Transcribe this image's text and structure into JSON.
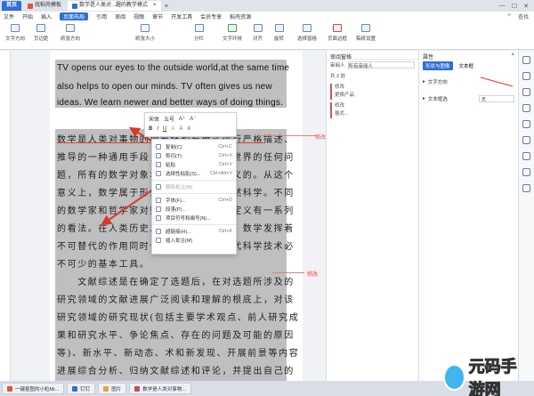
{
  "titlebar": {
    "tabs": [
      {
        "label": "首页",
        "color": "#2f6fd6"
      },
      {
        "label": "找稻壳模板",
        "color": "#e4543b"
      },
      {
        "label": "数学是人类对...趣的教学模式",
        "color": "#2f6fd6"
      }
    ]
  },
  "menubar": {
    "items": [
      "文件",
      "开始",
      "插入",
      "页面布局",
      "引用",
      "审阅",
      "视图",
      "章节",
      "开发工具",
      "会员专享",
      "稻壳资源"
    ],
    "active_index": 3,
    "search": "查找"
  },
  "ribbon": {
    "groups": [
      "文字方向",
      "页边距",
      "纸张方向",
      "纸张大小",
      "分栏",
      "文字环绕",
      "对齐",
      "旋转",
      "选择窗格",
      "页面边框",
      "稿纸设置"
    ]
  },
  "document": {
    "english_lines": [
      "TV opens our eyes to the outside world,at the same time",
      "also helps to open our minds. TV often gives us new",
      "ideas. We learn newer and better ways of doing things."
    ],
    "chinese_lines": [
      "数学是人类对事物的抽象结构与模式进行严格描述、",
      "推导的一种通用手段，可以应用于现实世界的任何问",
      "题，所有的数学对象本质上都是人为定义的。从这个",
      "意义上，数学属于形式科学，而不是自然科学。不同",
      "的数学家和哲学家对数学的确切范围和定义有一系列",
      "的看法。在人类历史发展和社会生活中，数学发挥着",
      "不可替代的作用同时也是学习和研究现代科学技术必",
      "不可少的基本工具。",
      "　　文献综述是在确定了选题后，在对选题所涉及的",
      "研究领域的文献进展广泛阅读和理解的根底上，对该",
      "研究领域的研究现状(包括主要学术观点、前人研究成",
      "果和研究水平、争论焦点、存在的问题及可能的原因",
      "等)、新水平、新动态、术和新发现、开展前景等内容",
      "进展综合分析、归纳文献综述和评论，并提出自己的"
    ]
  },
  "minitoolbar": {
    "font": "宋体",
    "size": "五号"
  },
  "context_menu": {
    "items": [
      {
        "label": "复制(C)",
        "shortcut": "Ctrl+C"
      },
      {
        "label": "剪切(T)",
        "shortcut": "Ctrl+X"
      },
      {
        "label": "粘贴",
        "shortcut": "Ctrl+V"
      },
      {
        "label": "选择性粘贴(S)...",
        "shortcut": "Ctrl+Alt+V"
      },
      {
        "label": "删除批注(M)",
        "shortcut": "",
        "dim": true
      },
      {
        "label": "字体(F)...",
        "shortcut": "Ctrl+D"
      },
      {
        "label": "段落(P)...",
        "shortcut": ""
      },
      {
        "label": "项目符号和编号(N)...",
        "shortcut": ""
      },
      {
        "label": "超链接(H)...",
        "shortcut": "Ctrl+K"
      },
      {
        "label": "插入批注(M)",
        "shortcut": ""
      }
    ]
  },
  "comments": {
    "marks": [
      "修改",
      "修改"
    ]
  },
  "review_panel": {
    "title": "审阅窗格",
    "reviewer_label": "审阅人",
    "reviewer_value": "所有审阅人",
    "count_text": "共 2 处",
    "block1_title": "修改",
    "block1_text": "更换产品",
    "block2_title": "修改",
    "block2_text": "格式..."
  },
  "property_panel": {
    "title": "属性",
    "tabs": [
      "形状与图像",
      "文本框"
    ],
    "row1": "文字方向",
    "row2": "文本框选",
    "row2_value": "无"
  },
  "taskbar": {
    "items": [
      {
        "label": "一键抠图的小粒Mr...",
        "color": "#e4543b"
      },
      {
        "label": "钉钉",
        "color": "#2f6fd6"
      },
      {
        "label": "图片",
        "color": "#e9a23b"
      },
      {
        "label": "数学是人类对事物...",
        "color": "#c0504d"
      }
    ]
  },
  "watermark": {
    "text": "元码手游网"
  }
}
